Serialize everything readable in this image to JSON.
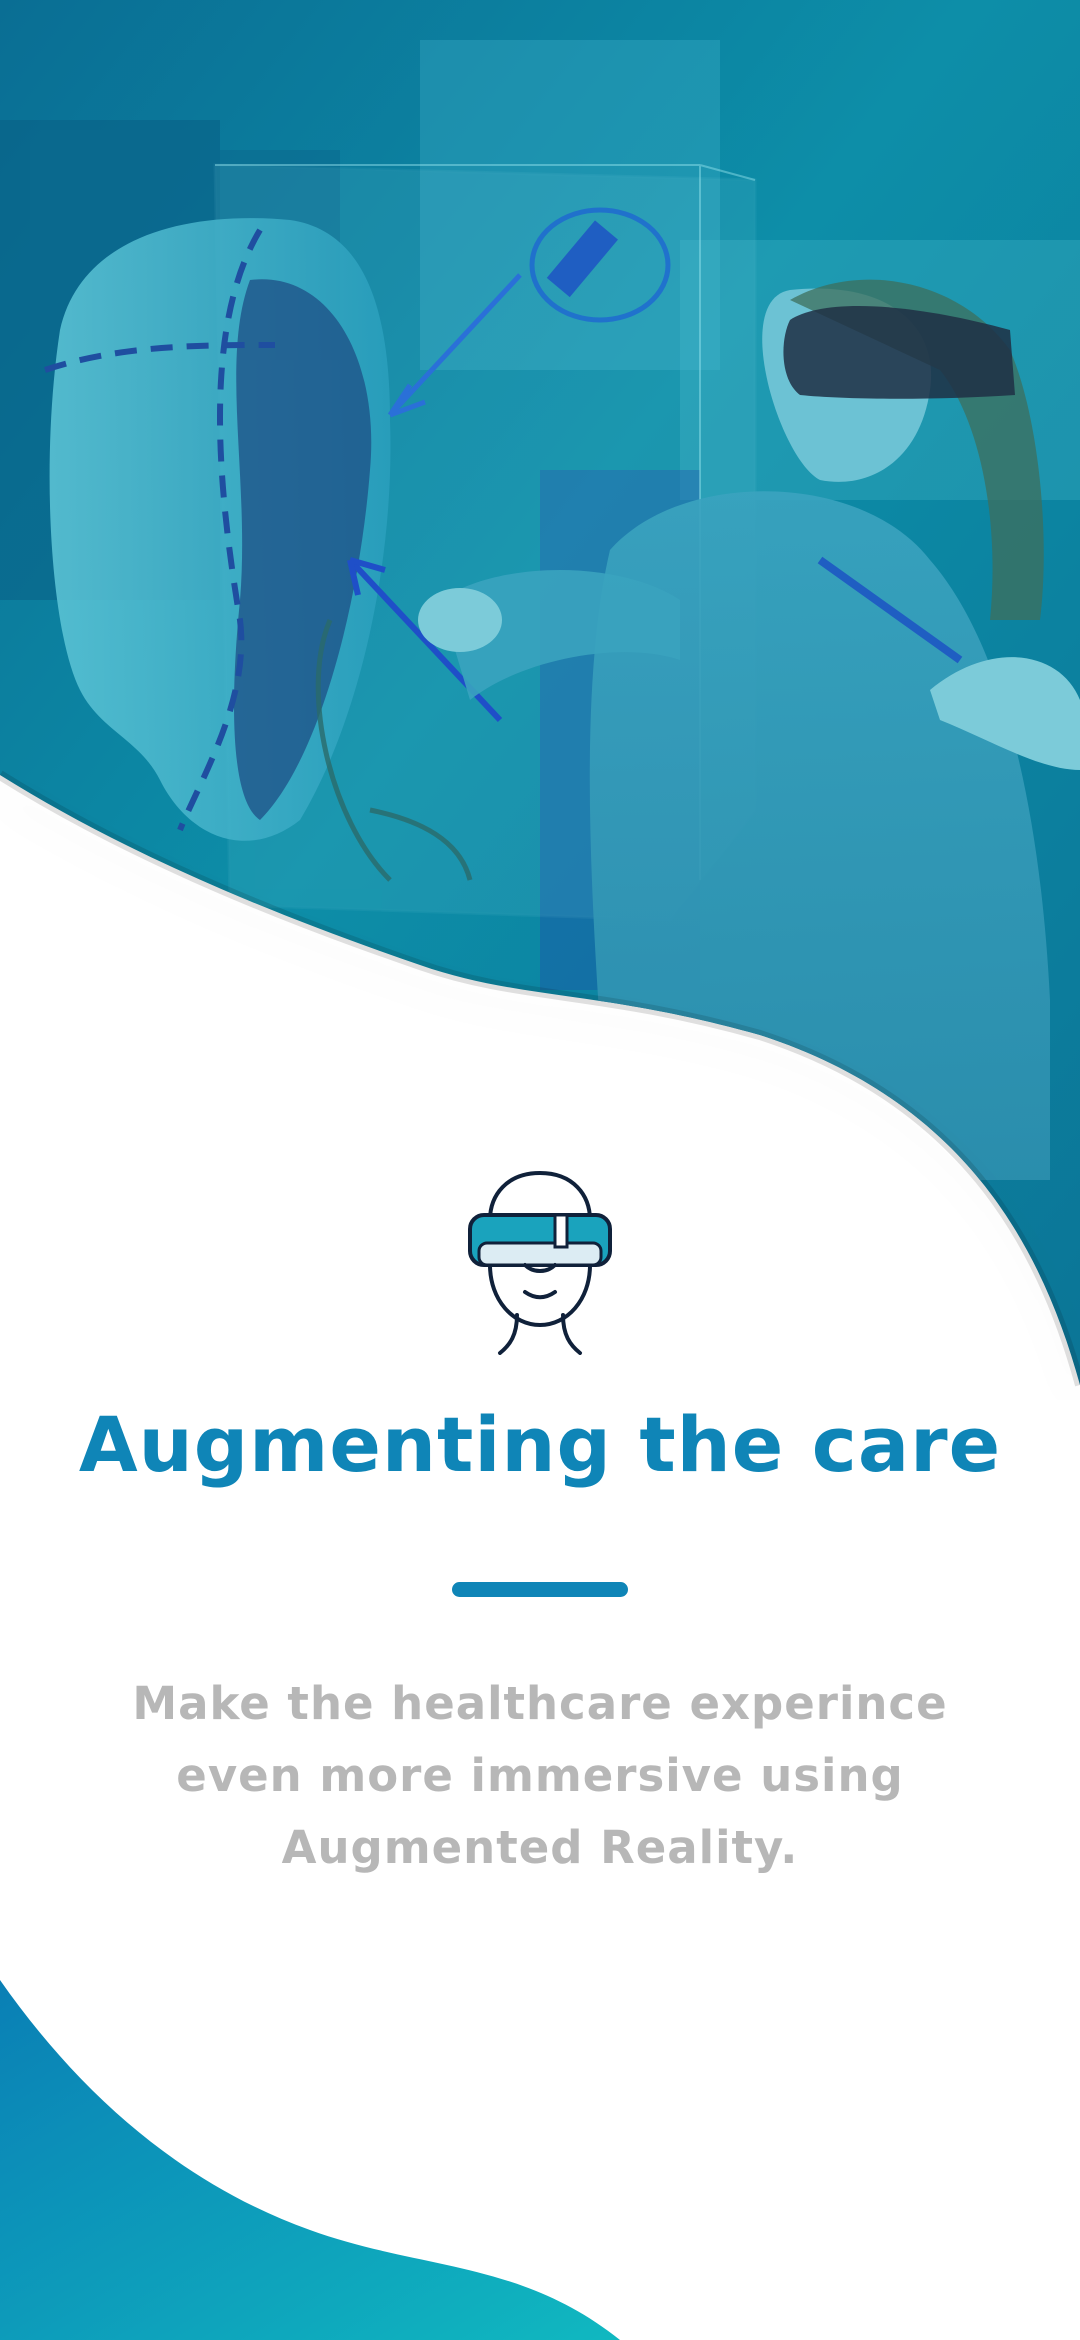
{
  "hero": {
    "image": "woman-wearing-ar-headset-interacting-with-holographic-head-model",
    "accent_color": "#0c8aab"
  },
  "content": {
    "icon": "vr-headset-icon",
    "title": "Augmenting the care",
    "description": "Make the healthcare experince even more immersive using Augmented Reality."
  },
  "colors": {
    "primary": "#0f85b7",
    "text_muted": "#b7b7b7",
    "gradient_start": "#0a7fb5",
    "gradient_end": "#0fb5c0"
  }
}
